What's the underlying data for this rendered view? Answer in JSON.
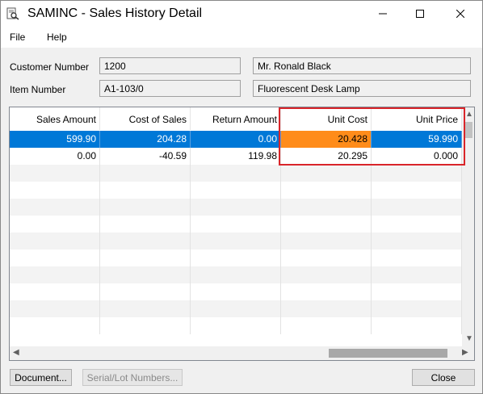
{
  "window": {
    "title": "SAMINC - Sales History Detail"
  },
  "menu": [
    "File",
    "Help"
  ],
  "customer": {
    "label": "Customer Number",
    "number": "1200",
    "name": "Mr. Ronald Black"
  },
  "item": {
    "label": "Item Number",
    "number": "A1-103/0",
    "description": "Fluorescent Desk Lamp"
  },
  "grid": {
    "columns": [
      "Sales Amount",
      "Cost of Sales",
      "Return Amount",
      "Unit Cost",
      "Unit Price"
    ],
    "rows": [
      [
        "599.90",
        "204.28",
        "0.00",
        "20.428",
        "59.990"
      ],
      [
        "0.00",
        "-40.59",
        "119.98",
        "20.295",
        "0.000"
      ]
    ],
    "selected_row": 0,
    "focused_column": 3
  },
  "buttons": {
    "document": "Document...",
    "serial_lot": "Serial/Lot Numbers...",
    "close": "Close"
  },
  "colors": {
    "selection": "#0078d7",
    "focus_cell": "#ff8c1a",
    "annotation": "#d9252a"
  }
}
